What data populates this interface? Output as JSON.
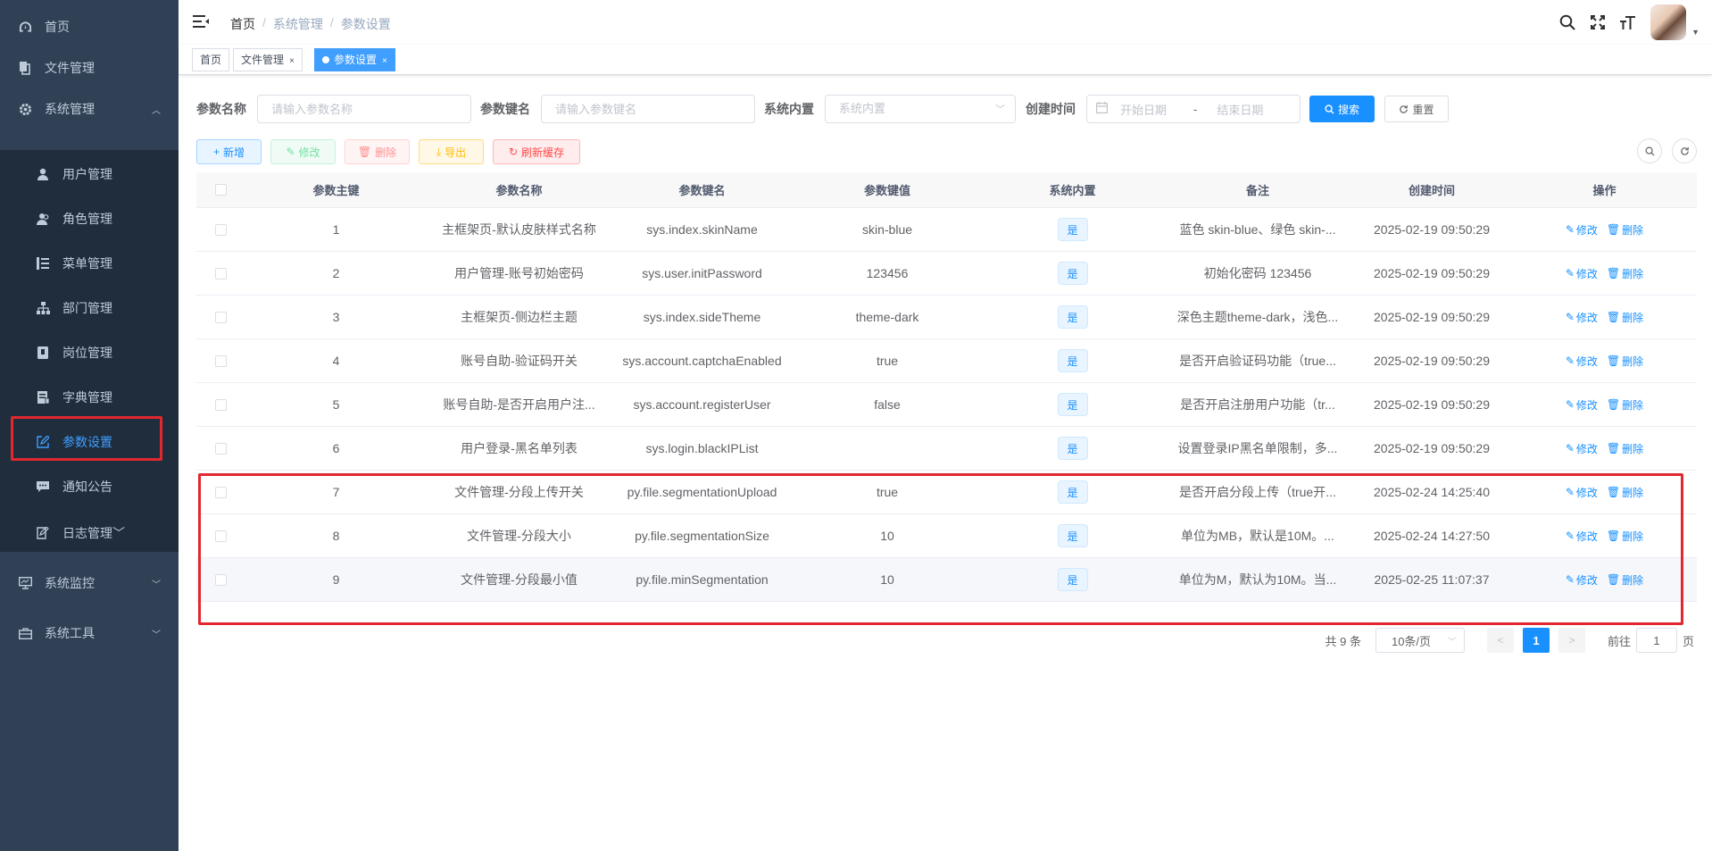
{
  "sidebar": {
    "items": [
      {
        "label": "首页",
        "icon": "dashboard-icon"
      },
      {
        "label": "文件管理",
        "icon": "file-icon"
      },
      {
        "label": "系统管理",
        "icon": "gear-icon"
      },
      {
        "label": "系统监控",
        "icon": "monitor-icon"
      },
      {
        "label": "系统工具",
        "icon": "toolbox-icon"
      }
    ],
    "sub_items": [
      {
        "label": "用户管理",
        "icon": "user-icon"
      },
      {
        "label": "角色管理",
        "icon": "users-icon"
      },
      {
        "label": "菜单管理",
        "icon": "tree-table-icon"
      },
      {
        "label": "部门管理",
        "icon": "org-tree-icon"
      },
      {
        "label": "岗位管理",
        "icon": "post-icon"
      },
      {
        "label": "字典管理",
        "icon": "dict-icon"
      },
      {
        "label": "参数设置",
        "icon": "edit-icon"
      },
      {
        "label": "通知公告",
        "icon": "message-icon"
      },
      {
        "label": "日志管理",
        "icon": "log-icon"
      }
    ]
  },
  "header": {
    "breadcrumb": [
      "首页",
      "系统管理",
      "参数设置"
    ],
    "separator": "/"
  },
  "tags": [
    {
      "label": "首页"
    },
    {
      "label": "文件管理",
      "close": "×"
    },
    {
      "label": "参数设置",
      "close": "×"
    }
  ],
  "search": {
    "param_name_label": "参数名称",
    "param_name_placeholder": "请输入参数名称",
    "param_key_label": "参数键名",
    "param_key_placeholder": "请输入参数键名",
    "builtin_label": "系统内置",
    "builtin_placeholder": "系统内置",
    "created_label": "创建时间",
    "start_placeholder": "开始日期",
    "range_sep": "-",
    "end_placeholder": "结束日期",
    "search_btn": "搜索",
    "reset_btn": "重置"
  },
  "toolbar": {
    "add": "新增",
    "edit": "修改",
    "delete": "删除",
    "export": "导出",
    "refresh_cache": "刷新缓存"
  },
  "table": {
    "headers": [
      "参数主键",
      "参数名称",
      "参数键名",
      "参数键值",
      "系统内置",
      "备注",
      "创建时间",
      "操作"
    ],
    "rows": [
      {
        "id": "1",
        "name": "主框架页-默认皮肤样式名称",
        "key": "sys.index.skinName",
        "value": "skin-blue",
        "builtin": "是",
        "remark": "蓝色 skin-blue、绿色 skin-...",
        "created": "2025-02-19 09:50:29"
      },
      {
        "id": "2",
        "name": "用户管理-账号初始密码",
        "key": "sys.user.initPassword",
        "value": "123456",
        "builtin": "是",
        "remark": "初始化密码 123456",
        "created": "2025-02-19 09:50:29"
      },
      {
        "id": "3",
        "name": "主框架页-侧边栏主题",
        "key": "sys.index.sideTheme",
        "value": "theme-dark",
        "builtin": "是",
        "remark": "深色主题theme-dark，浅色...",
        "created": "2025-02-19 09:50:29"
      },
      {
        "id": "4",
        "name": "账号自助-验证码开关",
        "key": "sys.account.captchaEnabled",
        "value": "true",
        "builtin": "是",
        "remark": "是否开启验证码功能（true...",
        "created": "2025-02-19 09:50:29"
      },
      {
        "id": "5",
        "name": "账号自助-是否开启用户注...",
        "key": "sys.account.registerUser",
        "value": "false",
        "builtin": "是",
        "remark": "是否开启注册用户功能（tr...",
        "created": "2025-02-19 09:50:29"
      },
      {
        "id": "6",
        "name": "用户登录-黑名单列表",
        "key": "sys.login.blackIPList",
        "value": "",
        "builtin": "是",
        "remark": "设置登录IP黑名单限制，多...",
        "created": "2025-02-19 09:50:29"
      },
      {
        "id": "7",
        "name": "文件管理-分段上传开关",
        "key": "py.file.segmentationUpload",
        "value": "true",
        "builtin": "是",
        "remark": "是否开启分段上传（true开...",
        "created": "2025-02-24 14:25:40"
      },
      {
        "id": "8",
        "name": "文件管理-分段大小",
        "key": "py.file.segmentationSize",
        "value": "10",
        "builtin": "是",
        "remark": "单位为MB，默认是10M。...",
        "created": "2025-02-24 14:27:50"
      },
      {
        "id": "9",
        "name": "文件管理-分段最小值",
        "key": "py.file.minSegmentation",
        "value": "10",
        "builtin": "是",
        "remark": "单位为M，默认为10M。当...",
        "created": "2025-02-25 11:07:37"
      }
    ],
    "op_edit": "修改",
    "op_delete": "删除"
  },
  "pagination": {
    "total": "共 9 条",
    "page_size": "10条/页",
    "current_page": "1",
    "goto_prefix": "前往",
    "goto_value": "1",
    "goto_suffix": "页"
  },
  "colors": {
    "sidebar_bg": "#304156",
    "submenu_bg": "#1f2d3d",
    "primary": "#1890ff",
    "highlight_red": "#e2272f"
  }
}
